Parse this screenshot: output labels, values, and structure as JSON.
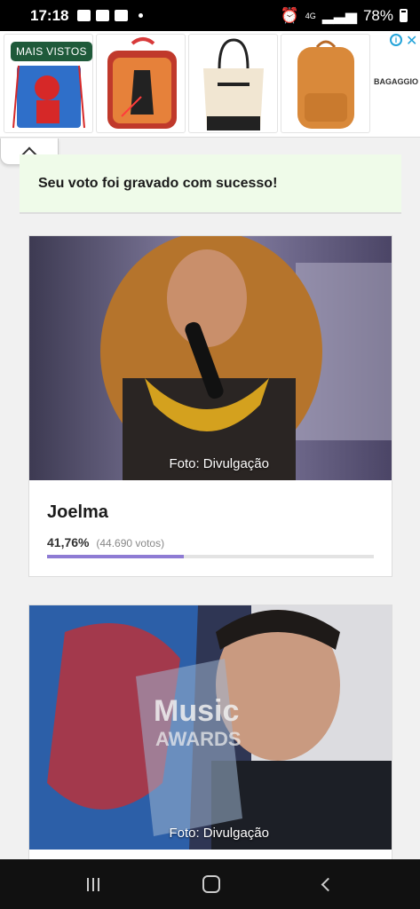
{
  "status_bar": {
    "time": "17:18",
    "network": "4G",
    "battery": "78%"
  },
  "ad": {
    "badge": "MAIS VISTOS",
    "brand_text": "BAGAGGIO"
  },
  "vote_message": "Seu voto foi gravado com sucesso!",
  "candidates": [
    {
      "name": "Joelma",
      "percent_label": "41,76%",
      "votes_label": "(44.690 votos)",
      "share": 0.4176,
      "photo_credit": "Foto: Divulgação"
    },
    {
      "photo_credit": "Foto: Divulgação"
    }
  ]
}
